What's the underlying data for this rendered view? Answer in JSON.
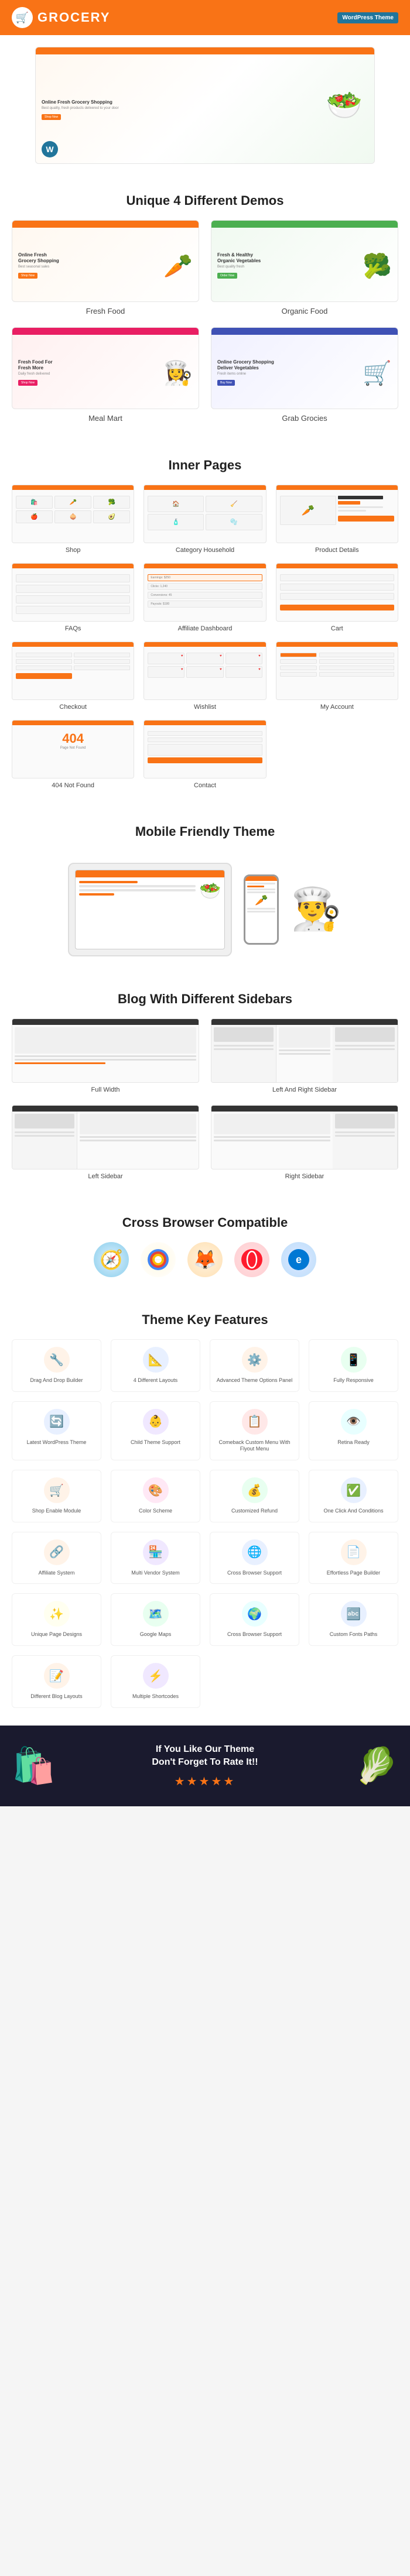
{
  "header": {
    "logo_text": "GROCERY",
    "wp_badge": "WordPress Theme"
  },
  "hero": {
    "title": "Online Fresh Grocery Shopping",
    "subtitle": "Best quality, fresh products delivered to your door",
    "cta": "Shop Now"
  },
  "demos_section": {
    "title": "Unique 4 Different Demos",
    "items": [
      {
        "label": "Fresh Food",
        "type": "fresh"
      },
      {
        "label": "Organic Food",
        "type": "organic"
      },
      {
        "label": "Meal Mart",
        "type": "mealmart"
      },
      {
        "label": "Grab Grocies",
        "type": "grab"
      }
    ]
  },
  "inner_pages_section": {
    "title": "Inner Pages",
    "items": [
      {
        "label": "Shop"
      },
      {
        "label": "Category Household"
      },
      {
        "label": "Product Details"
      },
      {
        "label": "FAQs"
      },
      {
        "label": "Affiliate Dashboard"
      },
      {
        "label": "Cart"
      },
      {
        "label": "Checkout"
      },
      {
        "label": "Wishlist"
      },
      {
        "label": "My Account"
      },
      {
        "label": "404 Not Found"
      },
      {
        "label": "Contact"
      }
    ]
  },
  "mobile_section": {
    "title": "Mobile Friendly Theme"
  },
  "blog_section": {
    "title": "Blog With Different Sidebars",
    "items": [
      {
        "label": "Full Width"
      },
      {
        "label": "Left And Right Sidebar"
      },
      {
        "label": "Left Sidebar"
      },
      {
        "label": "Right Sidebar"
      }
    ]
  },
  "browser_section": {
    "title": "Cross Browser Compatible",
    "browsers": [
      {
        "name": "Safari",
        "icon": "🧭"
      },
      {
        "name": "Chrome",
        "icon": "🌐"
      },
      {
        "name": "Firefox",
        "icon": "🦊"
      },
      {
        "name": "Opera",
        "icon": "⭕"
      },
      {
        "name": "IE",
        "icon": "🔵"
      }
    ]
  },
  "features_section": {
    "title": "Theme Key Features",
    "items": [
      {
        "label": "Drag And Drop Builder",
        "icon": "🔧",
        "bg": "orange"
      },
      {
        "label": "4 Different Layouts",
        "icon": "📐",
        "bg": "blue"
      },
      {
        "label": "Advanced Theme Options Panel",
        "icon": "⚙️",
        "bg": "orange"
      },
      {
        "label": "Fully Responsive",
        "icon": "📱",
        "bg": "green"
      },
      {
        "label": "Latest WordPress Theme",
        "icon": "🔄",
        "bg": "blue"
      },
      {
        "label": "Child Theme Support",
        "icon": "👶",
        "bg": "purple"
      },
      {
        "label": "Comeback Custom Menu With Flyout Menu",
        "icon": "📋",
        "bg": "red"
      },
      {
        "label": "Retina Ready",
        "icon": "👁️",
        "bg": "teal"
      },
      {
        "label": "Shop Enable Module",
        "icon": "🛒",
        "bg": "orange"
      },
      {
        "label": "Color Scheme",
        "icon": "🎨",
        "bg": "pink"
      },
      {
        "label": "Customized Refund",
        "icon": "💰",
        "bg": "green"
      },
      {
        "label": "One Click And Conditions",
        "icon": "✅",
        "bg": "blue"
      },
      {
        "label": "Affiliate System",
        "icon": "🔗",
        "bg": "orange"
      },
      {
        "label": "Multi Vendor System",
        "icon": "🏪",
        "bg": "purple"
      },
      {
        "label": "Cross Browser Support",
        "icon": "🌐",
        "bg": "blue"
      },
      {
        "label": "Effortless Page Builder",
        "icon": "📄",
        "bg": "orange"
      },
      {
        "label": "Unique Page Designs",
        "icon": "✨",
        "bg": "yellow"
      },
      {
        "label": "Google Maps",
        "icon": "🗺️",
        "bg": "green"
      },
      {
        "label": "Cross Browser Support",
        "icon": "🌍",
        "bg": "teal"
      },
      {
        "label": "Custom Fonts Paths",
        "icon": "🔤",
        "bg": "blue"
      },
      {
        "label": "Different Blog Layouts",
        "icon": "📝",
        "bg": "orange"
      },
      {
        "label": "Multiple Shortcodes",
        "icon": "⚡",
        "bg": "purple"
      }
    ]
  },
  "footer_cta": {
    "line1": "If You Like Our Theme",
    "line2": "Don't Forget To Rate It!!",
    "stars": "★★★★★"
  }
}
